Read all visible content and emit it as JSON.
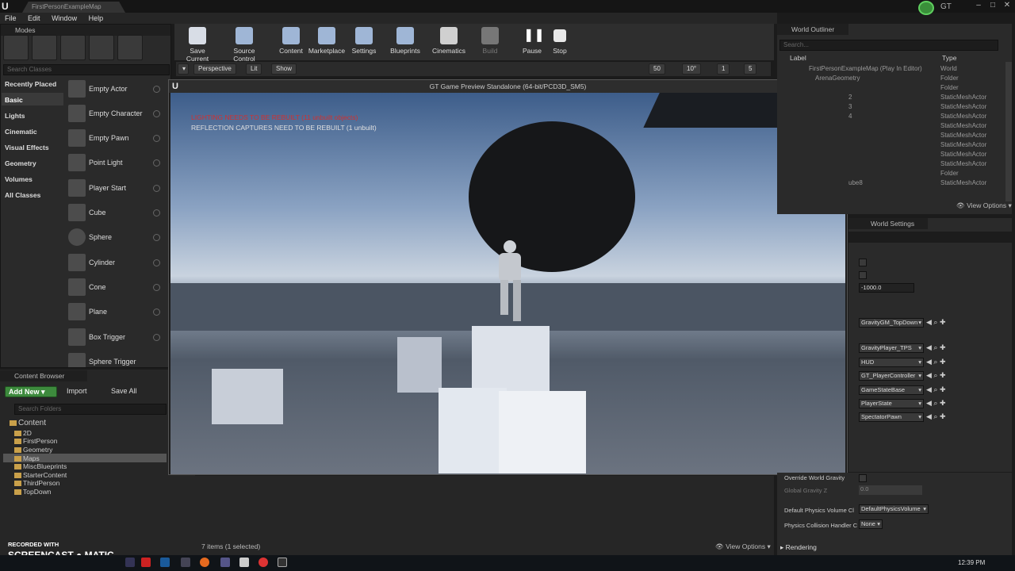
{
  "window": {
    "doc_tab": "FirstPersonExampleMap",
    "brand": "GT"
  },
  "menu": [
    "File",
    "Edit",
    "Window",
    "Help"
  ],
  "modes": {
    "tab": "Modes",
    "search_placeholder": "Search Classes",
    "categories": [
      "Recently Placed",
      "Basic",
      "Lights",
      "Cinematic",
      "Visual Effects",
      "Geometry",
      "Volumes",
      "All Classes"
    ],
    "selected_category": "Basic",
    "items": [
      "Empty Actor",
      "Empty Character",
      "Empty Pawn",
      "Point Light",
      "Player Start",
      "Cube",
      "Sphere",
      "Cylinder",
      "Cone",
      "Plane",
      "Box Trigger",
      "Sphere Trigger"
    ]
  },
  "toolbar": {
    "buttons": [
      "Save Current",
      "Source Control",
      "Content",
      "Marketplace",
      "Settings",
      "Blueprints",
      "Cinematics",
      "Build",
      "Pause",
      "Stop"
    ]
  },
  "viewport": {
    "perspective": "Perspective",
    "lit": "Lit",
    "show": "Show",
    "grid_snap": "50",
    "rot_snap": "10°",
    "scale_snap": "1",
    "cam_speed": "5"
  },
  "game": {
    "title": "GT Game Preview Standalone (64-bit/PCD3D_SM5)",
    "warning1": "LIGHTING NEEDS TO BE REBUILT (11 unbuilt objects)",
    "warning2": "REFLECTION CAPTURES NEED TO BE REBUILT (1 unbuilt)"
  },
  "outliner": {
    "tab": "World Outliner",
    "search_placeholder": "Search...",
    "col_label": "Label",
    "col_type": "Type",
    "rows": [
      {
        "label": "FirstPersonExampleMap (Play In Editor)",
        "type": "World"
      },
      {
        "label": "ArenaGeometry",
        "type": "Folder"
      },
      {
        "label": "",
        "type": "Folder"
      },
      {
        "label": "2",
        "type": "StaticMeshActor"
      },
      {
        "label": "3",
        "type": "StaticMeshActor"
      },
      {
        "label": "4",
        "type": "StaticMeshActor"
      },
      {
        "label": "",
        "type": "StaticMeshActor"
      },
      {
        "label": "",
        "type": "StaticMeshActor"
      },
      {
        "label": "",
        "type": "StaticMeshActor"
      },
      {
        "label": "",
        "type": "StaticMeshActor"
      },
      {
        "label": "",
        "type": "StaticMeshActor"
      },
      {
        "label": "",
        "type": "Folder"
      },
      {
        "label": "ube8",
        "type": "StaticMeshActor"
      }
    ],
    "view_options": "View Options"
  },
  "world_settings": {
    "tab": "World Settings",
    "kill_z": "-1000.0",
    "game_mode": "GravityGM_TopDown",
    "classes": [
      "GravityPlayer_TPS",
      "HUD",
      "GT_PlayerController",
      "GameStateBase",
      "PlayerState",
      "SpectatorPawn"
    ],
    "override_gravity": "Override World Gravity",
    "global_gravity": "Global Gravity Z",
    "global_gravity_val": "0.0",
    "phys_volume": "Default Physics Volume Cl",
    "phys_volume_val": "DefaultPhysicsVolume",
    "phys_handler": "Physics Collision Handler C",
    "phys_handler_val": "None",
    "rendering": "Rendering"
  },
  "content_browser": {
    "tab": "Content Browser",
    "add_new": "Add New",
    "import": "Import",
    "save_all": "Save All",
    "search_placeholder": "Search Folders",
    "root": "Content",
    "folders": [
      "2D",
      "FirstPerson",
      "Geometry",
      "Maps",
      "MiscBlueprints",
      "StarterContent",
      "ThirdPerson",
      "TopDown"
    ],
    "selected_folder": "Maps",
    "status": "7 items (1 selected)",
    "view_options": "View Options"
  },
  "watermark": {
    "line1": "RECORDED WITH",
    "line2": "SCREENCAST",
    "line3": "MATIC"
  },
  "taskbar": {
    "time": "12:39 PM"
  },
  "colors": {
    "accent_green": "#3d8a3d",
    "warning_red": "#d03030",
    "folder": "#c9a04a"
  }
}
